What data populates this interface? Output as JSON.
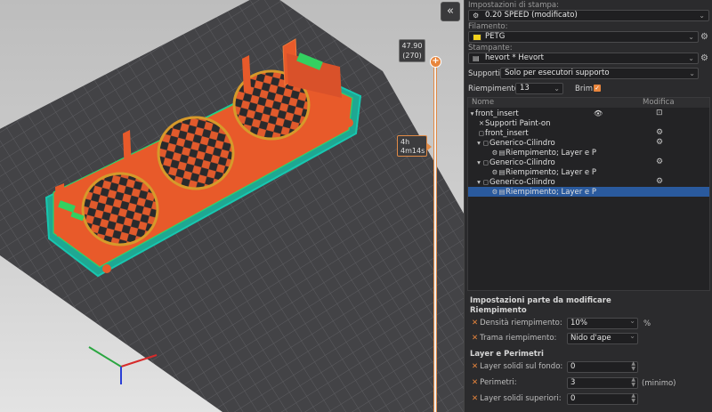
{
  "viewport": {
    "collapse_label": "«",
    "layer_label_top": "47.90",
    "layer_label_bottom": "(270)",
    "time_label_top": "4h",
    "time_label_bottom": "4m14s",
    "slider_thumb": "+",
    "colors": {
      "bed": "#3f3f42",
      "print": "#e9572a",
      "infill": "#d48b2a",
      "perimeter": "#19b3a3",
      "accent": "#e8853c"
    }
  },
  "sidebar": {
    "print_settings_label": "Impostazioni di stampa:",
    "print_profile": "0.20 SPEED (modificato)",
    "filament_label": "Filamento:",
    "filament_value": "PETG",
    "filament_color": "#f3d21d",
    "printer_label": "Stampante:",
    "printer_value": "hevort * Hevort",
    "supports_label": "Supporti:",
    "supports_value": "Solo per esecutori supporto",
    "infill_label": "Riempimento:",
    "infill_value": "13",
    "brim_label": "Brim:",
    "brim_check": "✓"
  },
  "tree": {
    "col_name": "Nome",
    "col_modify": "Modifica",
    "rows": [
      {
        "label": "front_insert",
        "indent": 0,
        "eye": "👁",
        "mod": "⊡"
      },
      {
        "label": "Supporti Paint-on",
        "indent": 1,
        "mod": ""
      },
      {
        "label": "front_insert",
        "indent": 1,
        "mod": "⚙"
      },
      {
        "label": "Generico-Cilindro",
        "indent": 1,
        "mod": "⚙"
      },
      {
        "label": "Riempimento; Layer e P",
        "indent": 2,
        "mod": ""
      },
      {
        "label": "Generico-Cilindro",
        "indent": 1,
        "mod": "⚙"
      },
      {
        "label": "Riempimento; Layer e P",
        "indent": 2,
        "mod": ""
      },
      {
        "label": "Generico-Cilindro",
        "indent": 1,
        "mod": "⚙"
      },
      {
        "label": "Riempimento; Layer e P",
        "indent": 2,
        "mod": ""
      }
    ]
  },
  "settings": {
    "title": "Impostazioni parte da modificare",
    "group_infill": "Riempimento",
    "density_label": "Densità riempimento:",
    "density_value": "10%",
    "density_unit": "%",
    "pattern_label": "Trama riempimento:",
    "pattern_value": "Nido d'ape",
    "group_layers": "Layer e Perimetri",
    "bottom_layers_label": "Layer solidi sul fondo:",
    "bottom_layers_value": "0",
    "perimeters_label": "Perimetri:",
    "perimeters_value": "3",
    "perimeters_unit": "(minimo)",
    "top_layers_label": "Layer solidi superiori:",
    "top_layers_value": "0"
  }
}
